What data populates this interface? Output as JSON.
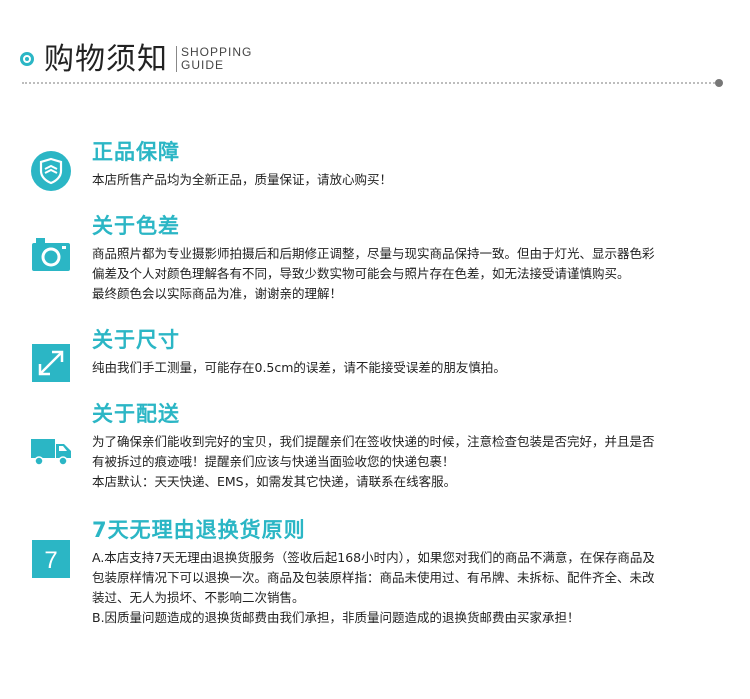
{
  "header": {
    "title": "购物须知",
    "subtitle_line1": "SHOPPING",
    "subtitle_line2": "GUIDE"
  },
  "colors": {
    "accent": "#2bb6c5",
    "text": "#222222"
  },
  "sections": [
    {
      "icon": "shield-icon",
      "title": "正品保障",
      "lines": [
        "本店所售产品均为全新正品，质量保证，请放心购买！"
      ]
    },
    {
      "icon": "camera-icon",
      "title": "关于色差",
      "lines": [
        "商品照片都为专业摄影师拍摄后和后期修正调整，尽量与现实商品保持一致。但由于灯光、显示器色彩",
        "偏差及个人对颜色理解各有不同，导致少数实物可能会与照片存在色差，如无法接受请谨慎购买。",
        "最终颜色会以实际商品为准，谢谢亲的理解！"
      ]
    },
    {
      "icon": "resize-arrow-icon",
      "title": "关于尺寸",
      "lines": [
        "纯由我们手工测量，可能存在0.5cm的误差，请不能接受误差的朋友慎拍。"
      ]
    },
    {
      "icon": "truck-icon",
      "title": "关于配送",
      "lines": [
        "为了确保亲们能收到完好的宝贝，我们提醒亲们在签收快递的时候，注意检查包装是否完好，并且是否",
        "有被拆过的痕迹哦！提醒亲们应该与快递当面验收您的快递包裹！",
        "本店默认：天天快递、EMS，如需发其它快递，请联系在线客服。"
      ]
    },
    {
      "icon": "seven-icon",
      "icon_text": "7",
      "title": "7天无理由退换货原则",
      "lines": [
        "A.本店支持7天无理由退换货服务（签收后起168小时内），如果您对我们的商品不满意，在保存商品及",
        "包装原样情况下可以退换一次。商品及包装原样指：商品未使用过、有吊牌、未拆标、配件齐全、未改",
        "装过、无人为损坏、不影响二次销售。",
        "B.因质量问题造成的退换货邮费由我们承担，非质量问题造成的退换货邮费由买家承担！"
      ]
    }
  ]
}
